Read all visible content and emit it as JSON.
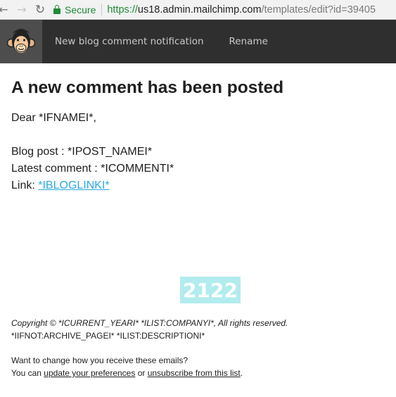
{
  "browser": {
    "back_icon": "arrow-left-icon",
    "forward_icon": "arrow-right-icon",
    "reload_icon": "reload-icon",
    "lock_icon": "lock-icon",
    "secure_label": "Secure",
    "url_scheme": "https://",
    "url_host": "us18.admin.mailchimp.com",
    "url_path": "/templates/edit?id=39405"
  },
  "header": {
    "logo_icon": "mailchimp-monkey-icon",
    "template_name": "New blog comment notification",
    "rename_label": "Rename"
  },
  "email": {
    "heading": "A new comment has been posted",
    "greeting": "Dear  *IFNAMEI*,",
    "blog_post_line": "Blog post : *IPOST_NAMEI*",
    "latest_comment_line": "Latest comment : *ICOMMENTI*",
    "link_label": "Link: ",
    "link_text": "*IBLOGLINKI*",
    "logo_placeholder": "2122",
    "copyright": "Copyright © *ICURRENT_YEARI* *ILIST:COMPANYI*, All rights reserved.",
    "archive_line": "*IIFNOT:ARCHIVE_PAGEI* *ILIST:DESCRIPTIONI*",
    "change_question": "Want to change how you receive these emails?",
    "prefs_prefix": "You can ",
    "update_prefs_link": "update your preferences",
    "prefs_or": " or ",
    "unsubscribe_link": "unsubscribe from this list",
    "prefs_suffix": "."
  },
  "colors": {
    "secure_green": "#1f8a3a",
    "header_bg": "#2f2f2f",
    "link_blue": "#2baadf",
    "placeholder_bg": "#b2ecee"
  }
}
